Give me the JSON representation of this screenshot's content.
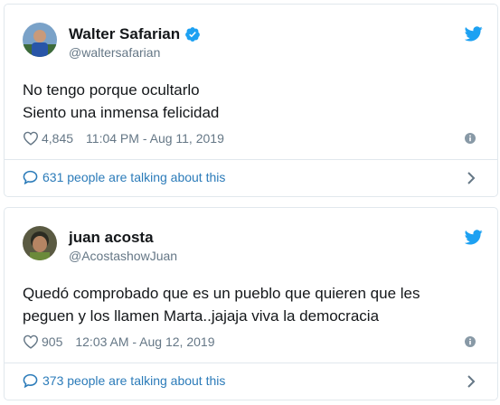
{
  "tweets": [
    {
      "display_name": "Walter Safarian",
      "handle": "@waltersafarian",
      "verified": true,
      "text_lines": [
        "No tengo porque ocultarlo",
        "Siento una inmensa felicidad"
      ],
      "likes": "4,845",
      "timestamp": "11:04 PM - Aug 11, 2019",
      "talking": "631 people are talking about this",
      "icons": [
        "avatar",
        "verified-badge-icon",
        "twitter-bird-icon",
        "heart-icon",
        "info-icon",
        "speech-bubble-icon",
        "chevron-right-icon"
      ]
    },
    {
      "display_name": "juan acosta",
      "handle": "@AcostashowJuan",
      "verified": false,
      "text_lines": [
        "Quedó comprobado que es un pueblo que quieren que les",
        "peguen y los llamen Marta..jajaja viva la democracia"
      ],
      "likes": "905",
      "timestamp": "12:03 AM - Aug 12, 2019",
      "talking": "373 people are talking about this",
      "icons": [
        "avatar",
        "twitter-bird-icon",
        "heart-icon",
        "info-icon",
        "speech-bubble-icon",
        "chevron-right-icon"
      ]
    }
  ],
  "colors": {
    "text": "#14171a",
    "secondary": "#657786",
    "link": "#2b7bb9",
    "twitter_blue": "#1da1f2",
    "border": "#e1e8ed"
  }
}
